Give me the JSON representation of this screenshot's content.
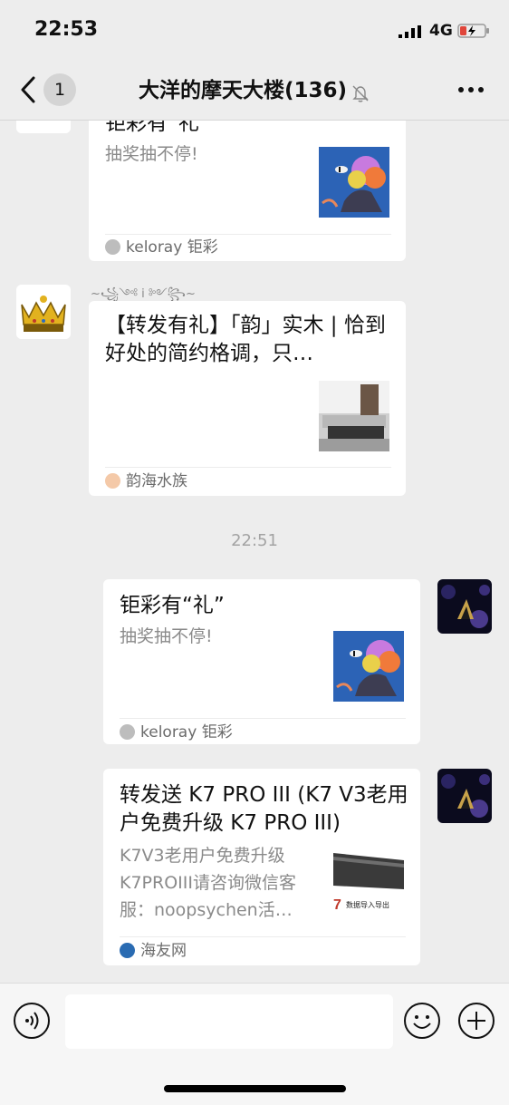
{
  "status_bar": {
    "time": "22:53",
    "network": "4G"
  },
  "header": {
    "unread_count": "1",
    "title": "大洋的摩天大楼(136)"
  },
  "messages": [
    {
      "direction": "in",
      "title": "钜彩有“礼”",
      "desc": "抽奖抽不停!",
      "source": "keloray 钜彩"
    },
    {
      "direction": "in",
      "sender_nickname": "~꧁༺ i ༻꧂~",
      "title": "【转发有礼】「韵」实木 | 恰到好处的简约格调，只…",
      "source": "韵海水族"
    },
    {
      "type": "timestamp",
      "text": "22:51"
    },
    {
      "direction": "out",
      "title": "钜彩有“礼”",
      "desc": "抽奖抽不停!",
      "source": "keloray 钜彩"
    },
    {
      "direction": "out",
      "title": "转发送 K7 PRO III (K7 V3老用户免费升级 K7 PRO III)",
      "desc": "K7V3老用户免费升级K7PROIII请咨询微信客服：noopsychen活…",
      "source": "海友网",
      "thumb_caption": "数据导入导出"
    }
  ],
  "colors": {
    "background": "#ededed",
    "card": "#ffffff",
    "accent_red": "#e0463b"
  }
}
